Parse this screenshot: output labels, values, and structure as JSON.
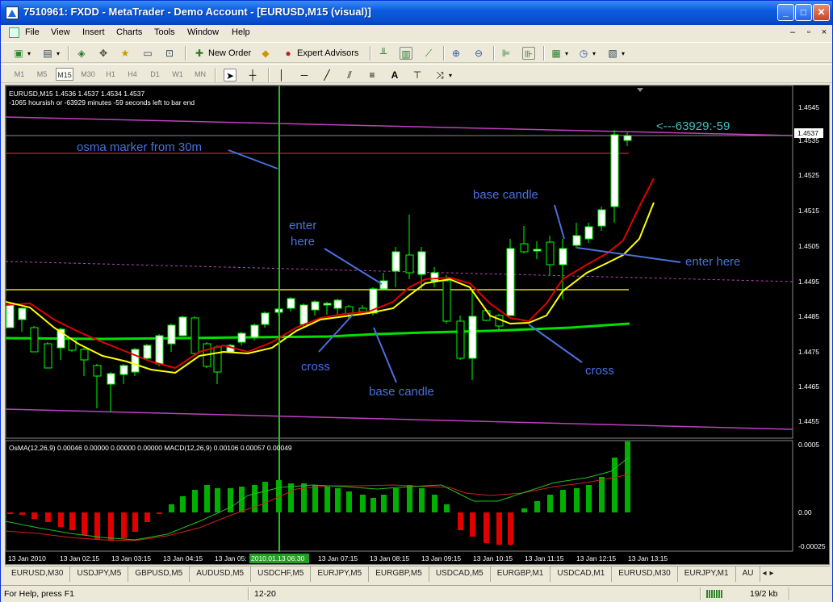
{
  "window": {
    "title": "7510961: FXDD - MetaTrader - Demo Account - [EURUSD,M15 (visual)]",
    "minimize": "_",
    "maximize": "□",
    "close": "✕"
  },
  "menu": {
    "items": [
      "File",
      "View",
      "Insert",
      "Charts",
      "Tools",
      "Window",
      "Help"
    ],
    "mdi": [
      "–",
      "▫",
      "×"
    ]
  },
  "toolbar1": {
    "new_order": "New Order",
    "expert_advisors": "Expert Advisors"
  },
  "toolbar2": {
    "timeframes": [
      "M1",
      "M5",
      "M15",
      "M30",
      "H1",
      "H4",
      "D1",
      "W1",
      "MN"
    ],
    "active_timeframe": "M15",
    "text_tool": "A"
  },
  "chart": {
    "info_line1": "EURUSD,M15 1.4536 1.4537 1.4534 1.4537",
    "info_line2": "-1065 hoursish or -63929 minutes -59 seconds left to bar end",
    "countdown": "<---63929:-59",
    "price_labels": [
      "1.4545",
      "1.4535",
      "1.4525",
      "1.4515",
      "1.4505",
      "1.4495",
      "1.4485",
      "1.4475",
      "1.4465",
      "1.4455"
    ],
    "current_price": "1.4537",
    "annotations": {
      "osma_marker": "osma marker from 30m",
      "enter1_line1": "enter",
      "enter1_line2": "here",
      "base_candle_top": "base candle",
      "enter_here_right": "enter here",
      "cross_left": "cross",
      "base_candle_bottom": "base candle",
      "cross_right": "cross"
    },
    "indicator_label": "OsMA(12,26,9) 0.00046 0.00000 0.00000 0.00000  MACD(12,26,9) 0.00106 0.00057 0.00049",
    "indicator_scale": [
      "0.0005",
      "0.00",
      "-0.00025"
    ],
    "time_labels": [
      "13 Jan 2010",
      "13 Jan 02:15",
      "13 Jan 03:15",
      "13 Jan 04:15",
      "13 Jan 05:",
      "13 Jan 07:15",
      "13 Jan 08:15",
      "13 Jan 09:15",
      "13 Jan 10:15",
      "13 Jan 11:15",
      "13 Jan 12:15",
      "13 Jan 13:15"
    ],
    "crosshair_time": "2010.01.13 06:30",
    "colors": {
      "background": "#000000",
      "bull_candle": "#ffffff",
      "bear_candle": "#000000",
      "candle_wick": "#00ff00",
      "ma_red": "#ff0000",
      "ma_yellow": "#ffff00",
      "ma_green": "#00ff00",
      "channel": "#c040c0",
      "annotation_text": "#4a6fe0",
      "countdown_text": "#40c0c0",
      "osma_positive": "#00c000",
      "osma_negative": "#ff0000"
    }
  },
  "tabs": [
    "EURUSD,M30",
    "USDJPY,M5",
    "GBPUSD,M5",
    "AUDUSD,M5",
    "USDCHF,M5",
    "EURJPY,M5",
    "EURGBP,M5",
    "USDCAD,M5",
    "EURGBP,M1",
    "USDCAD,M1",
    "EURUSD,M30",
    "EURJPY,M1",
    "AU"
  ],
  "status": {
    "help": "For Help, press F1",
    "profile": "12-20",
    "traffic": "19/2 kb"
  }
}
